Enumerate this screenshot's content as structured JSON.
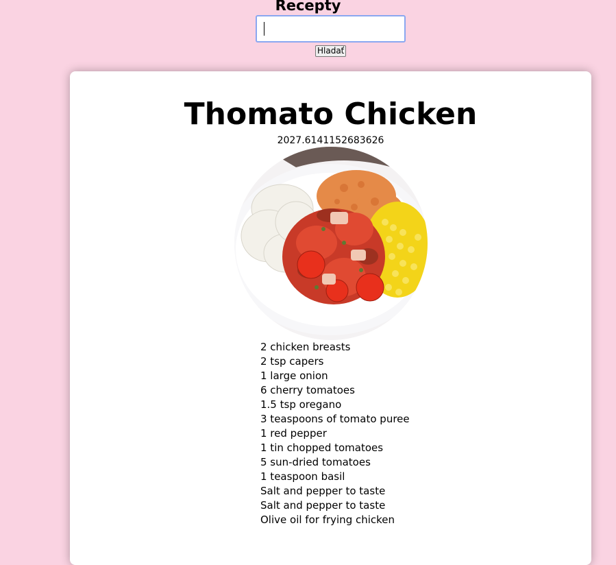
{
  "header": {
    "title": "Recepty",
    "search": {
      "value": "",
      "placeholder": ""
    },
    "search_button_label": "Hladať"
  },
  "recipe": {
    "title": "Thomato Chicken",
    "score": "2027.6141152683626",
    "ingredients": [
      "2 chicken breasts",
      "2 tsp capers",
      "1 large onion",
      "6 cherry tomatoes",
      "1.5 tsp oregano",
      "3 teaspoons of tomato puree",
      "1 red pepper",
      "1 tin chopped tomatoes",
      "5 sun-dried tomatoes",
      "1 teaspoon basil",
      "Salt and pepper to taste",
      "Salt and pepper to taste",
      "Olive oil for frying chicken"
    ]
  },
  "colors": {
    "page_background": "#fad3e2",
    "card_background": "#ffffff",
    "input_focus_border": "#8aa7f0"
  }
}
